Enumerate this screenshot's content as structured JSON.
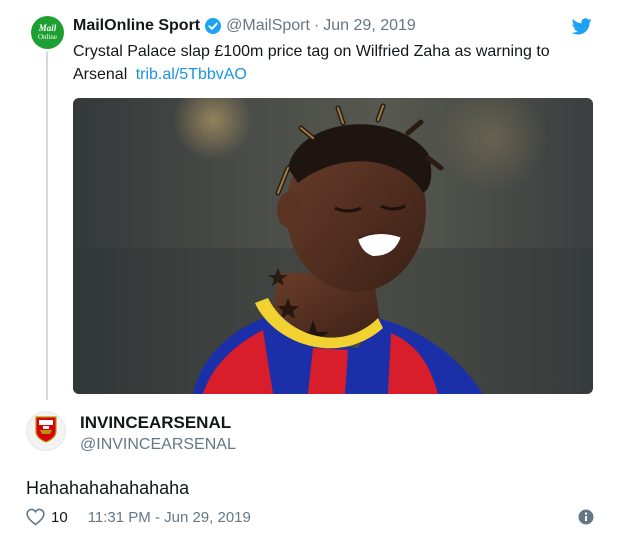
{
  "quoted_tweet": {
    "avatar": {
      "line1": "Mail",
      "line2": "Online"
    },
    "author_name": "MailOnline Sport",
    "handle": "@MailSport",
    "separator": "·",
    "date": "Jun 29, 2019",
    "text": "Crystal Palace slap £100m price tag on Wilfried Zaha as warning to Arsenal",
    "link": "trib.al/5TbbvAO",
    "verified": true,
    "icons": [
      "verified-icon",
      "twitter-bird-icon"
    ],
    "media": {
      "description": "footballer-photo"
    }
  },
  "reply_tweet": {
    "author_name": "INVINCEARSENAL",
    "handle": "@INVINCEARSENAL",
    "text": "Hahahahahahahaha",
    "like_count": "10",
    "timestamp": "11:31 PM - Jun 29, 2019",
    "icons": [
      "heart-icon",
      "info-icon",
      "arsenal-crest-icon"
    ]
  },
  "colors": {
    "brand_blue": "#1da1f2",
    "link_blue": "#1b95e0",
    "mail_green": "#1da032",
    "secondary_text": "#657786",
    "arsenal_red": "#db0007"
  }
}
